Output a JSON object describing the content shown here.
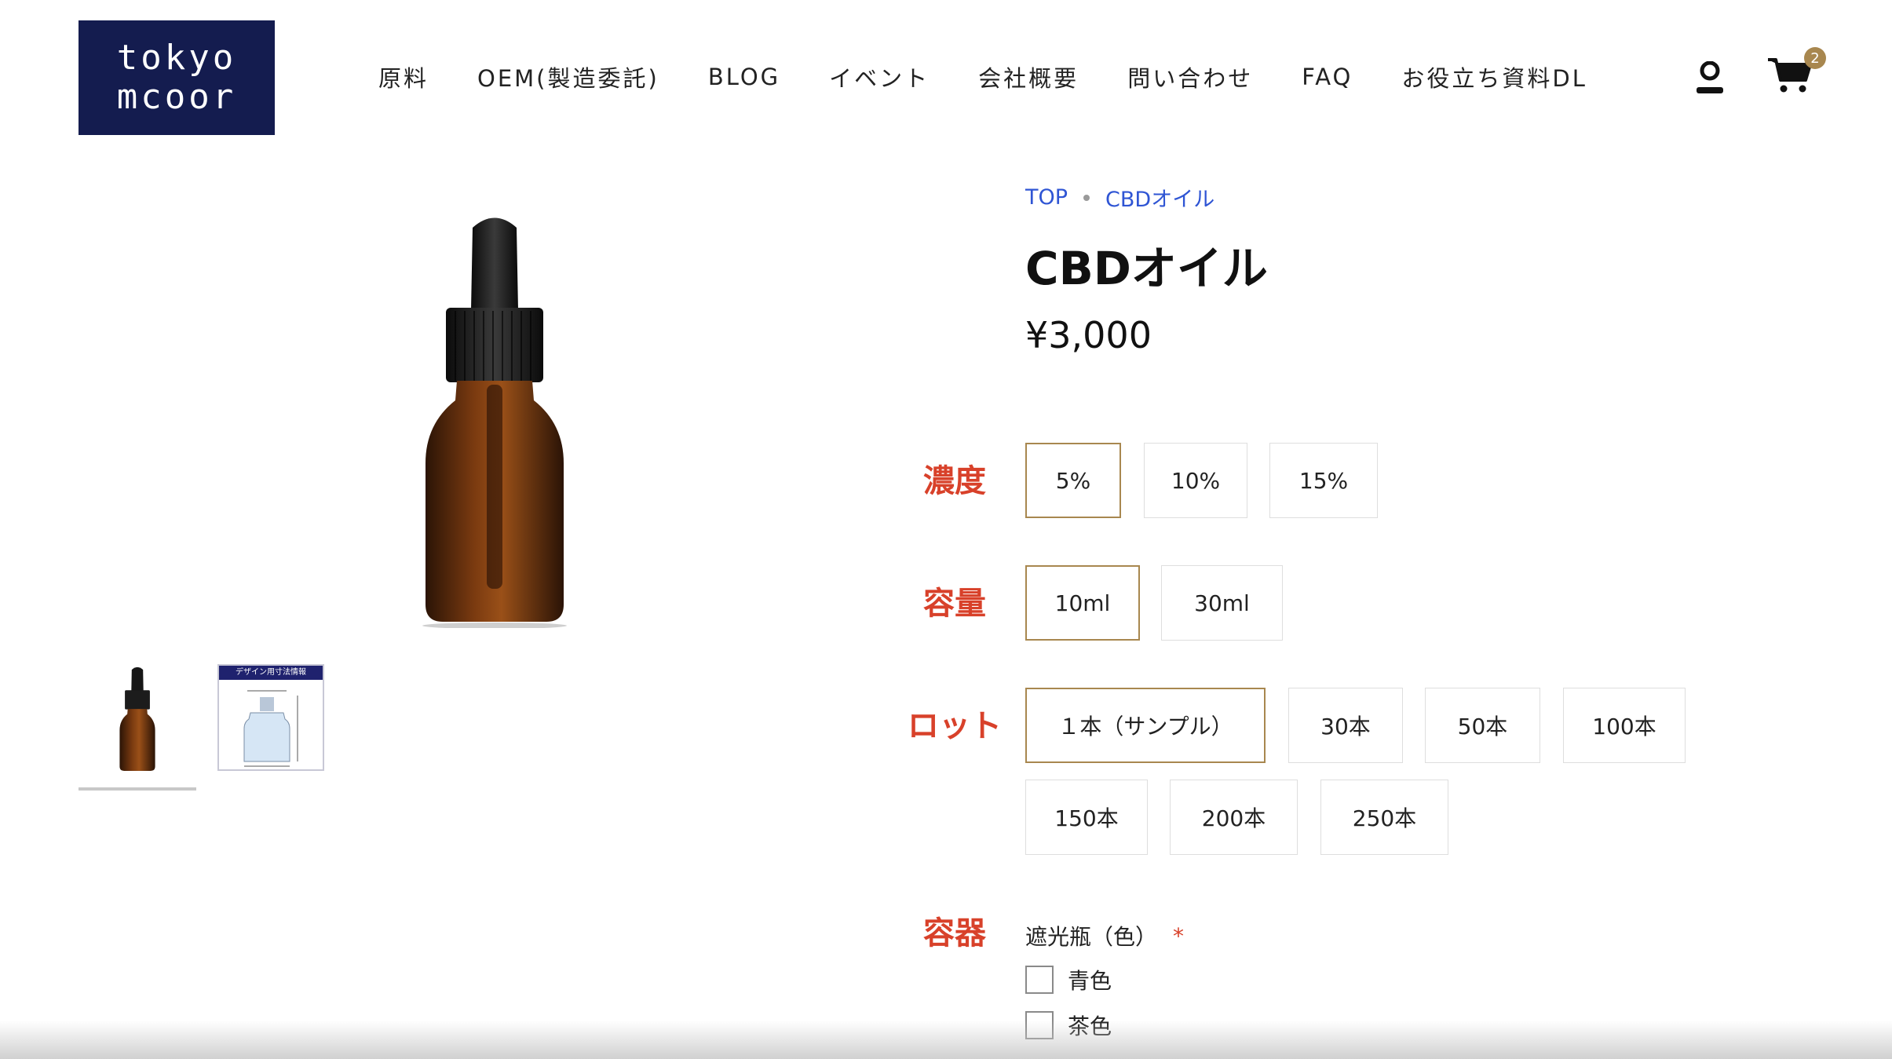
{
  "brand": {
    "logo_line1": "tokyo",
    "logo_line2": "mcoor"
  },
  "nav": [
    {
      "label": "原料"
    },
    {
      "label": "OEM(製造委託)"
    },
    {
      "label": "BLOG"
    },
    {
      "label": "イベント"
    },
    {
      "label": "会社概要"
    },
    {
      "label": "問い合わせ"
    },
    {
      "label": "FAQ"
    },
    {
      "label": "お役立ち資料DL"
    }
  ],
  "cart": {
    "count": "2"
  },
  "icons": {
    "user": "user-icon",
    "cart": "cart-icon"
  },
  "breadcrumb": [
    {
      "label": "TOP"
    },
    {
      "label": "CBDオイル"
    }
  ],
  "product": {
    "title": "CBDオイル",
    "price": "¥3,000"
  },
  "thumbnails": {
    "thumb2_header": "デザイン用寸法情報"
  },
  "options": {
    "concentration": {
      "label": "濃度",
      "choices": [
        "5%",
        "10%",
        "15%"
      ],
      "selected": "5%"
    },
    "volume": {
      "label": "容量",
      "choices": [
        "10ml",
        "30ml"
      ],
      "selected": "10ml"
    },
    "lot": {
      "label": "ロット",
      "choices": [
        "１本（サンプル）",
        "30本",
        "50本",
        "100本",
        "150本",
        "200本",
        "250本"
      ],
      "selected": "１本（サンプル）"
    },
    "container": {
      "label": "容器",
      "sub_label": "遮光瓶（色）",
      "required_mark": "*",
      "checkboxes": [
        {
          "label": "青色",
          "checked": false
        },
        {
          "label": "茶色",
          "checked": false
        }
      ]
    }
  },
  "colors": {
    "accent": "#a8874f",
    "label_red": "#d8412a",
    "link_blue": "#2f55d4",
    "logo_navy": "#141c4f"
  }
}
